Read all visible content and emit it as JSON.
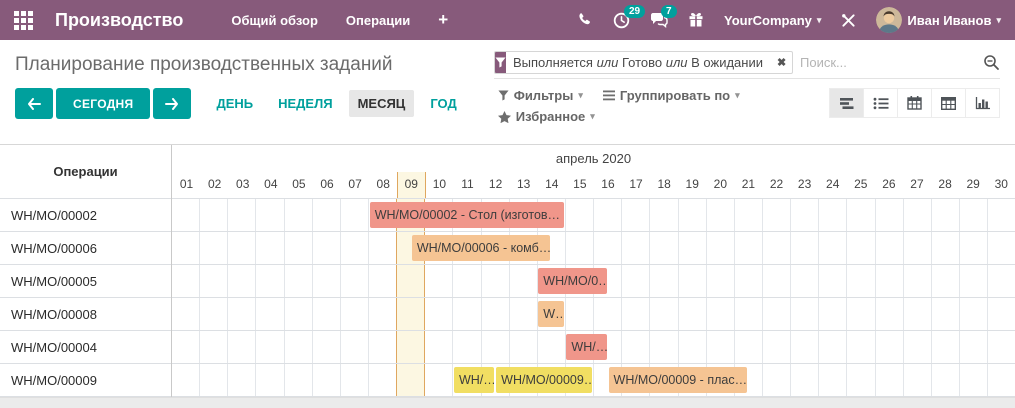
{
  "topbar": {
    "app_title": "Производство",
    "menu_items": [
      {
        "label": "Общий обзор"
      },
      {
        "label": "Операции"
      }
    ],
    "plus_label": "+",
    "activities_badge": "29",
    "messages_badge": "7",
    "company": "YourCompany",
    "user_name": "Иван Иванов"
  },
  "page": {
    "title": "Планирование производственных заданий"
  },
  "search": {
    "facet": {
      "values": [
        "Выполняется",
        "Готово",
        "В ожидании"
      ],
      "joiner": "или"
    },
    "placeholder": "Поиск..."
  },
  "controls": {
    "today_label": "СЕГОДНЯ",
    "scales": [
      {
        "label": "ДЕНЬ",
        "active": false
      },
      {
        "label": "НЕДЕЛЯ",
        "active": false
      },
      {
        "label": "МЕСЯЦ",
        "active": true
      },
      {
        "label": "ГОД",
        "active": false
      }
    ],
    "filters_label": "Фильтры",
    "groupby_label": "Группировать по",
    "favorites_label": "Избранное"
  },
  "gantt": {
    "row_header": "Операции",
    "month_label": "апрель 2020",
    "days": [
      "01",
      "02",
      "03",
      "04",
      "05",
      "06",
      "07",
      "08",
      "09",
      "10",
      "11",
      "12",
      "13",
      "14",
      "15",
      "16",
      "17",
      "18",
      "19",
      "20",
      "21",
      "22",
      "23",
      "24",
      "25",
      "26",
      "27",
      "28",
      "29",
      "30"
    ],
    "today_day": 9,
    "rows": [
      {
        "label": "WH/MO/00002",
        "bars": [
          {
            "label": "WH/MO/00002 - Стол (изготов…",
            "start": 8,
            "end": 15,
            "color": "salmon"
          }
        ]
      },
      {
        "label": "WH/MO/00006",
        "bars": [
          {
            "label": "WH/MO/00006 - комб…",
            "start": 9.5,
            "end": 14.5,
            "color": "orange"
          }
        ]
      },
      {
        "label": "WH/MO/00005",
        "bars": [
          {
            "label": "WH/MO/0…",
            "start": 14,
            "end": 16.5,
            "color": "salmon"
          }
        ]
      },
      {
        "label": "WH/MO/00008",
        "bars": [
          {
            "label": "W…",
            "start": 14,
            "end": 15,
            "color": "orange"
          }
        ]
      },
      {
        "label": "WH/MO/00004",
        "bars": [
          {
            "label": "WH/…",
            "start": 15,
            "end": 16.5,
            "color": "salmon"
          }
        ]
      },
      {
        "label": "WH/MO/00009",
        "bars": [
          {
            "label": "WH/…",
            "start": 11,
            "end": 12.5,
            "color": "yellow"
          },
          {
            "label": "WH/MO/00009…",
            "start": 12.5,
            "end": 16,
            "color": "yellow"
          },
          {
            "label": "WH/MO/00009 - плас…",
            "start": 16.5,
            "end": 21.5,
            "color": "orange"
          }
        ]
      }
    ]
  },
  "icons": {
    "facet_remove": "✖",
    "caret": "▾"
  },
  "colors": {
    "brand": "#875A7B",
    "accent": "#00A09D",
    "salmon": "#F0968A",
    "orange": "#F5C493",
    "yellow": "#F1DE62",
    "today_bg": "#FCF7E2",
    "today_border": "#DFA75F"
  }
}
